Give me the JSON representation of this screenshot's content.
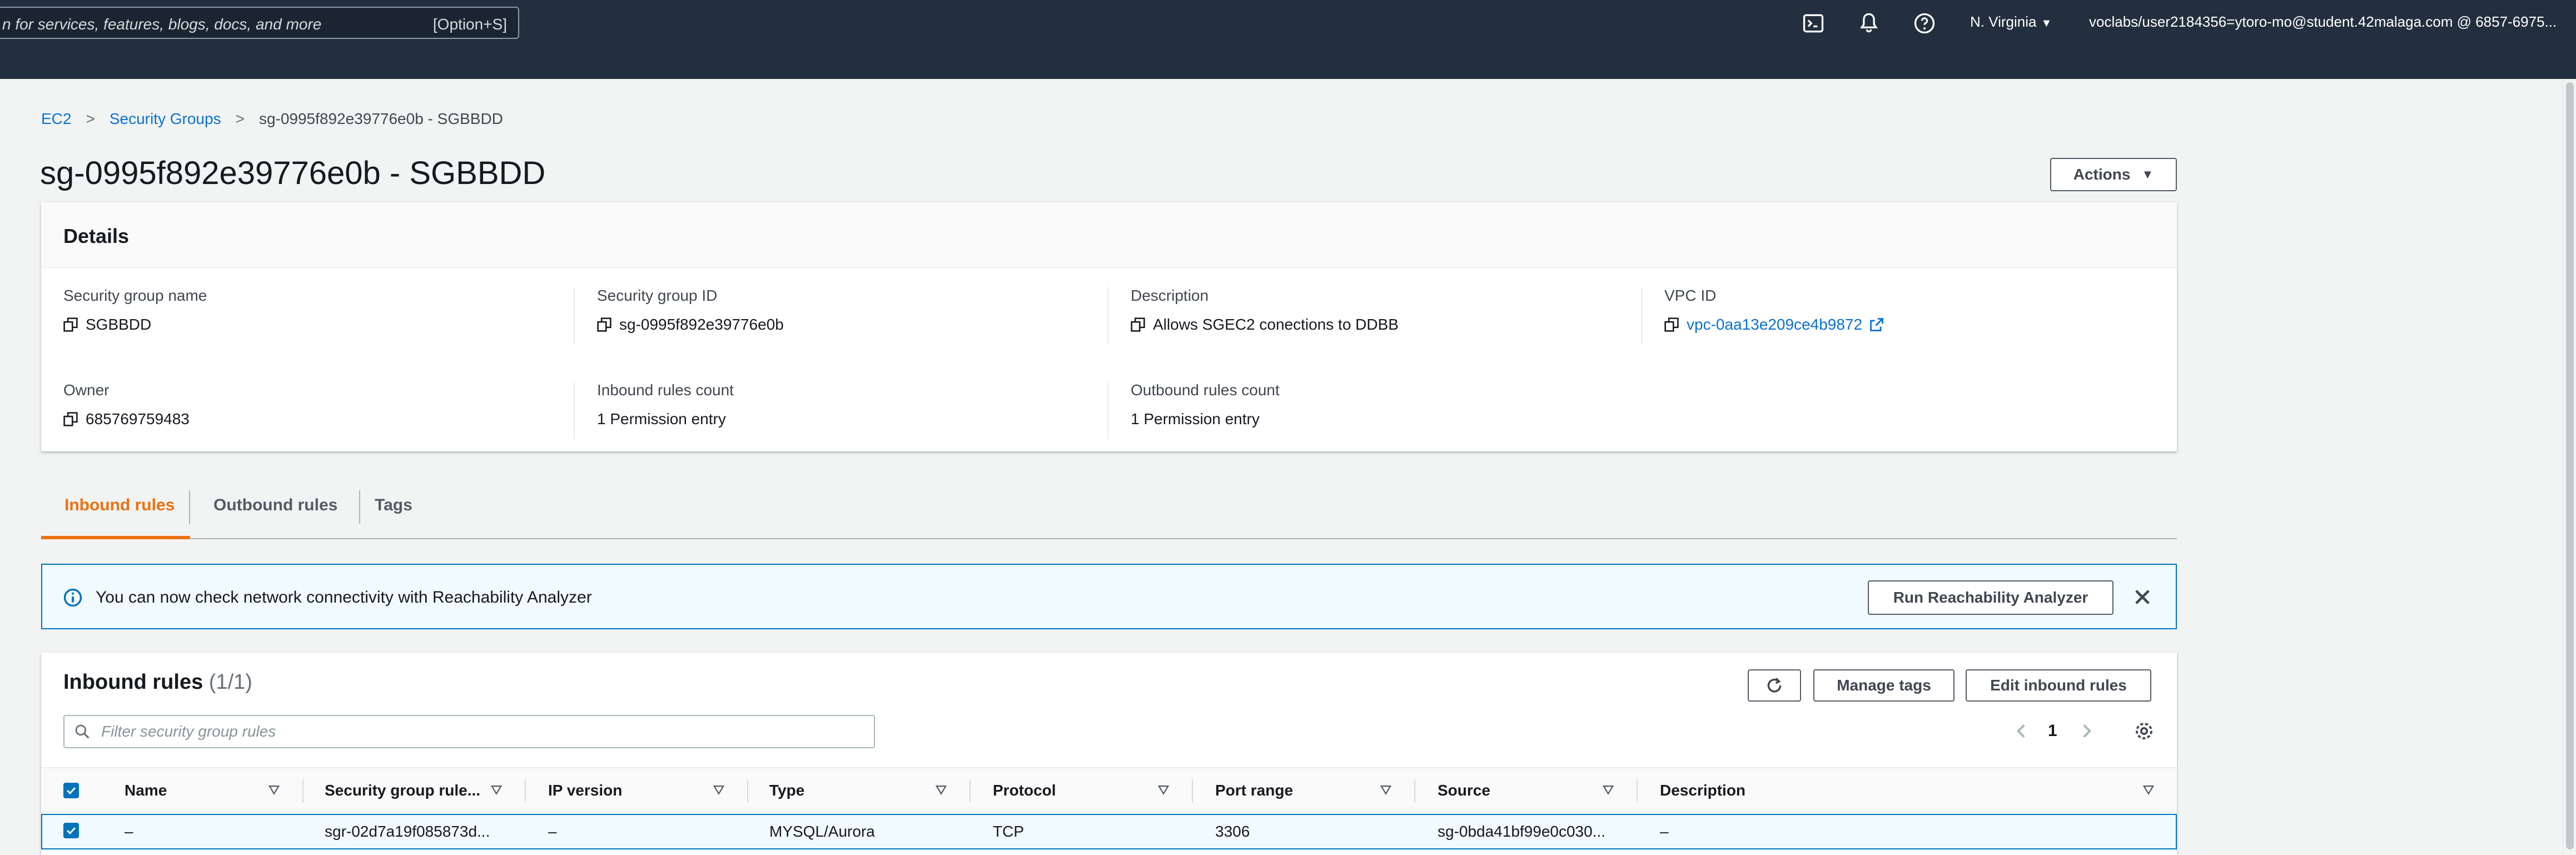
{
  "topbar": {
    "search_placeholder": "n for services, features, blogs, docs, and more",
    "search_shortcut": "[Option+S]",
    "region": "N. Virginia",
    "account": "voclabs/user2184356=ytoro-mo@student.42malaga.com @ 6857-6975..."
  },
  "breadcrumb": {
    "items": [
      "EC2",
      "Security Groups",
      "sg-0995f892e39776e0b - SGBBDD"
    ]
  },
  "page": {
    "title": "sg-0995f892e39776e0b - SGBBDD",
    "actions_label": "Actions"
  },
  "details": {
    "title": "Details",
    "fields": [
      {
        "label": "Security group name",
        "value": "SGBBDD"
      },
      {
        "label": "Security group ID",
        "value": "sg-0995f892e39776e0b"
      },
      {
        "label": "Description",
        "value": "Allows SGEC2 conections to DDBB"
      },
      {
        "label": "VPC ID",
        "value": "vpc-0aa13e209ce4b9872"
      },
      {
        "label": "Owner",
        "value": "685769759483"
      },
      {
        "label": "Inbound rules count",
        "value": "1 Permission entry"
      },
      {
        "label": "Outbound rules count",
        "value": "1 Permission entry"
      }
    ]
  },
  "tabs": [
    {
      "label": "Inbound rules",
      "active": true
    },
    {
      "label": "Outbound rules",
      "active": false
    },
    {
      "label": "Tags",
      "active": false
    }
  ],
  "alert": {
    "text": "You can now check network connectivity with Reachability Analyzer",
    "button_label": "Run Reachability Analyzer"
  },
  "inbound": {
    "title": "Inbound rules",
    "count": "(1/1)",
    "manage_tags_label": "Manage tags",
    "edit_label": "Edit inbound rules",
    "filter_placeholder": "Filter security group rules",
    "page": "1",
    "columns": [
      "Name",
      "Security group rule...",
      "IP version",
      "Type",
      "Protocol",
      "Port range",
      "Source",
      "Description"
    ],
    "rows": [
      [
        "–",
        "sgr-02d7a19f085873d...",
        "–",
        "MYSQL/Aurora",
        "TCP",
        "3306",
        "sg-0bda41bf99e0c030...",
        "–"
      ]
    ]
  },
  "colors": {
    "nav_bg": "#232f3e",
    "link": "#0972d3",
    "active_tab": "#ec7211",
    "info_border": "#0073bb"
  }
}
